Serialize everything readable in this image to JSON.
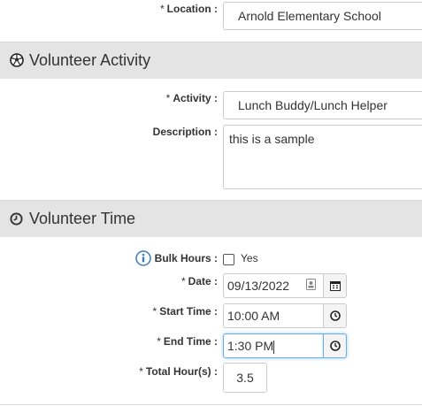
{
  "location": {
    "label": "Location :",
    "required": "*",
    "value": "Arnold Elementary School"
  },
  "activity_section": {
    "title": "Volunteer Activity",
    "icon": "soccer-ball-icon"
  },
  "activity": {
    "label": "Activity :",
    "required": "*",
    "value": "Lunch Buddy/Lunch Helper"
  },
  "description": {
    "label": "Description :",
    "value": "this is a sample"
  },
  "time_section": {
    "title": "Volunteer Time",
    "icon": "clock-icon"
  },
  "bulk_hours": {
    "label": "Bulk Hours :",
    "checkbox_label": "Yes",
    "checked": false,
    "icon": "info-circle-icon"
  },
  "date": {
    "label": "Date :",
    "required": "*",
    "value": "09/13/2022"
  },
  "start_time": {
    "label": "Start Time :",
    "required": "*",
    "value": "10:00 AM"
  },
  "end_time": {
    "label": "End Time :",
    "required": "*",
    "value": "1:30 PM"
  },
  "total_hours": {
    "label": "Total Hour(s) :",
    "required": "*",
    "value": "3.5"
  },
  "colors": {
    "section_bg": "#e4e4e4",
    "focus": "#66afe9",
    "info": "#3a7bbf"
  }
}
